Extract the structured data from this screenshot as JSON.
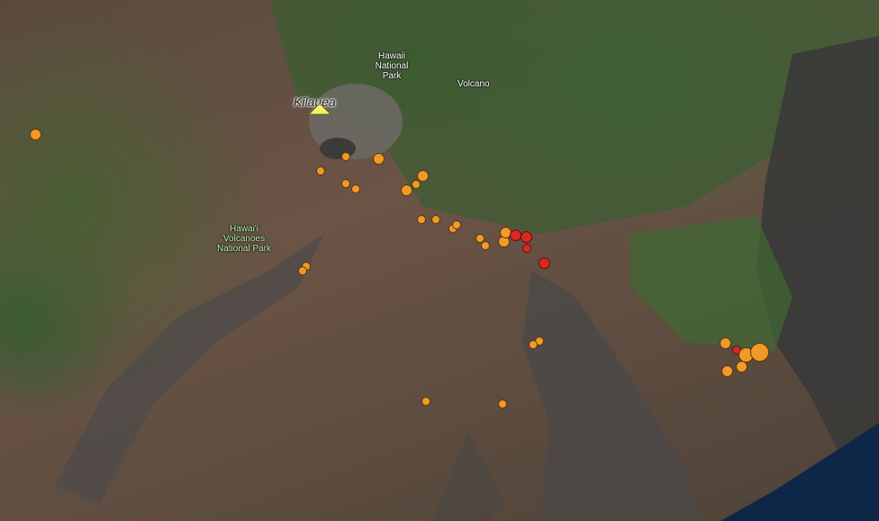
{
  "map": {
    "labels": {
      "hawaii_national_park": [
        "Hawaii",
        "National",
        "Park"
      ],
      "volcano_town": "Volcano",
      "kilauea": "Kilauea",
      "volcanoes_national_park": [
        "Hawai'i",
        "Volcanoes",
        "National Park"
      ]
    },
    "marker": {
      "type": "volcano-triangle",
      "color": "#f4f26a"
    },
    "colors": {
      "quake_recent": "#d62a22",
      "quake_older": "#f19a27"
    },
    "earthquakes": [
      {
        "id": "q1",
        "color": "orange",
        "size": "M"
      },
      {
        "id": "q2",
        "color": "orange",
        "size": "S"
      },
      {
        "id": "q3",
        "color": "orange",
        "size": "M"
      },
      {
        "id": "q4",
        "color": "orange",
        "size": "S"
      },
      {
        "id": "q5",
        "color": "orange",
        "size": "S"
      },
      {
        "id": "q6",
        "color": "orange",
        "size": "S"
      },
      {
        "id": "q7",
        "color": "orange",
        "size": "M"
      },
      {
        "id": "q8",
        "color": "orange",
        "size": "M"
      },
      {
        "id": "q9",
        "color": "orange",
        "size": "S"
      },
      {
        "id": "q10",
        "color": "orange",
        "size": "S"
      },
      {
        "id": "q11",
        "color": "orange",
        "size": "S"
      },
      {
        "id": "q12",
        "color": "orange",
        "size": "S"
      },
      {
        "id": "q13",
        "color": "orange",
        "size": "S"
      },
      {
        "id": "q14",
        "color": "orange",
        "size": "S"
      },
      {
        "id": "q15",
        "color": "orange",
        "size": "S"
      },
      {
        "id": "q16",
        "color": "orange",
        "size": "M"
      },
      {
        "id": "q17",
        "color": "orange",
        "size": "M"
      },
      {
        "id": "q18",
        "color": "red",
        "size": "M"
      },
      {
        "id": "q19",
        "color": "red",
        "size": "M"
      },
      {
        "id": "q20",
        "color": "red",
        "size": "S"
      },
      {
        "id": "q21",
        "color": "red",
        "size": "M"
      },
      {
        "id": "q22",
        "color": "orange",
        "size": "S"
      },
      {
        "id": "q23",
        "color": "orange",
        "size": "S"
      },
      {
        "id": "q24",
        "color": "orange",
        "size": "S"
      },
      {
        "id": "q25",
        "color": "orange",
        "size": "S"
      },
      {
        "id": "q26",
        "color": "orange",
        "size": "M"
      },
      {
        "id": "q27",
        "color": "red",
        "size": "S"
      },
      {
        "id": "q28",
        "color": "orange",
        "size": "L"
      },
      {
        "id": "q29",
        "color": "orange",
        "size": "XL"
      },
      {
        "id": "q30",
        "color": "orange",
        "size": "M"
      },
      {
        "id": "q31",
        "color": "orange",
        "size": "M"
      },
      {
        "id": "q32",
        "color": "orange",
        "size": "S"
      },
      {
        "id": "q33",
        "color": "orange",
        "size": "S"
      }
    ]
  }
}
